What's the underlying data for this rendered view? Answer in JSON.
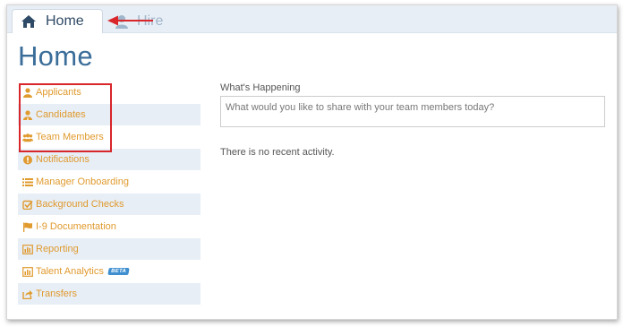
{
  "tabs": [
    {
      "label": "Home",
      "icon": "home-icon",
      "active": true
    },
    {
      "label": "Hire",
      "icon": "person-icon",
      "active": false
    }
  ],
  "page_title": "Home",
  "sidebar": {
    "items": [
      {
        "label": "Applicants",
        "icon": "person-icon"
      },
      {
        "label": "Candidates",
        "icon": "person-tie-icon"
      },
      {
        "label": "Team Members",
        "icon": "group-icon"
      },
      {
        "label": "Notifications",
        "icon": "exclamation-circle-icon"
      },
      {
        "label": "Manager Onboarding",
        "icon": "list-icon"
      },
      {
        "label": "Background Checks",
        "icon": "checkbox-icon"
      },
      {
        "label": "I-9 Documentation",
        "icon": "flag-icon"
      },
      {
        "label": "Reporting",
        "icon": "bar-chart-icon"
      },
      {
        "label": "Talent Analytics",
        "icon": "bar-chart-icon",
        "badge": "BETA"
      },
      {
        "label": "Transfers",
        "icon": "share-icon"
      }
    ]
  },
  "feed": {
    "heading": "What's Happening",
    "placeholder": "What would you like to share with your team members today?",
    "empty_message": "There is no recent activity."
  },
  "colors": {
    "title": "#3a6d99",
    "nav_text": "#e09a2e",
    "nav_alt_row": "#e7eef6",
    "tabbar": "#e8eef5",
    "annotation_red": "#d8262b",
    "beta_badge": "#3f8fd0"
  }
}
